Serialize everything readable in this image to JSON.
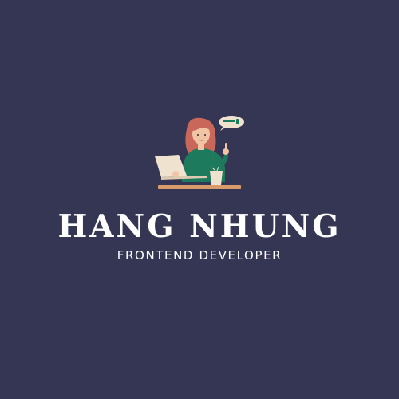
{
  "logo": {
    "name": "HANG NHUNG",
    "role": "FRONTEND DEVELOPER",
    "illustration": "woman-with-laptop-illustration",
    "colors": {
      "background": "#353654",
      "text": "#ffffff",
      "hair": "#c9675a",
      "sweater": "#1d7a5c",
      "skin": "#f2c4a6",
      "laptop": "#efe2cf",
      "desk": "#d99a6c"
    }
  }
}
